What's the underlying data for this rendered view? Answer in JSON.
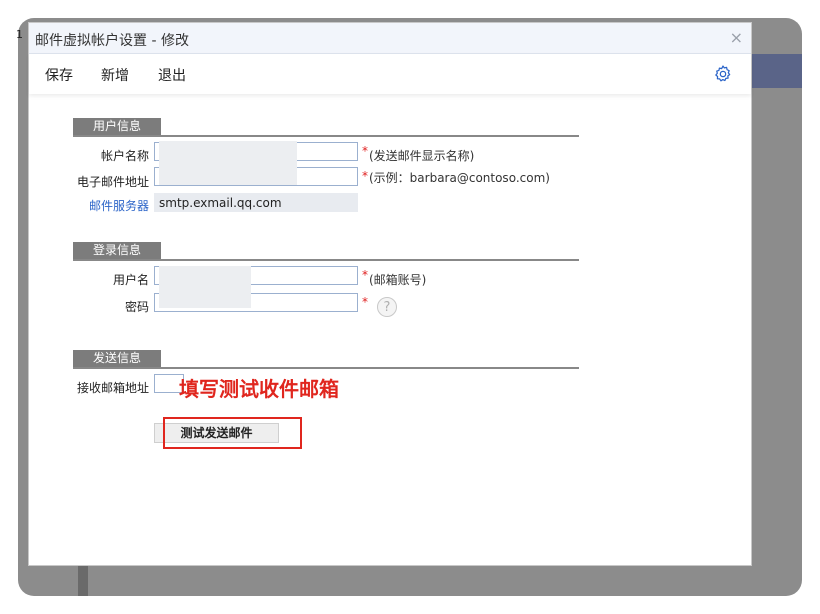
{
  "window": {
    "title": "邮件虚拟帐户设置 - 修改",
    "close_label": "×",
    "corner_label": "1"
  },
  "toolbar": {
    "save_label": "保存",
    "new_label": "新增",
    "exit_label": "退出",
    "settings_icon": "gear-icon"
  },
  "sections": {
    "user_info": {
      "heading": "用户信息",
      "account_name_label": "帐户名称",
      "account_name_value": "",
      "account_name_hint": "(发送邮件显示名称)",
      "email_label": "电子邮件地址",
      "email_value": "",
      "email_hint": "(示例：barbara@contoso.com)",
      "server_label": "邮件服务器",
      "server_value": "smtp.exmail.qq.com",
      "required_mark": "*"
    },
    "login_info": {
      "heading": "登录信息",
      "username_label": "用户名",
      "username_value": "",
      "username_hint": "(邮箱账号)",
      "password_label": "密码",
      "password_value": "",
      "help_icon": "question-icon",
      "help_glyph": "?"
    },
    "send_info": {
      "heading": "发送信息",
      "receiver_label": "接收邮箱地址",
      "receiver_value": "",
      "test_button_label": "测试发送邮件"
    }
  },
  "annotation": {
    "text": "填写测试收件邮箱",
    "color": "#e0261e"
  },
  "colors": {
    "section_tab": "#7c7c7c",
    "link": "#2b64c8",
    "required": "#e02020"
  }
}
